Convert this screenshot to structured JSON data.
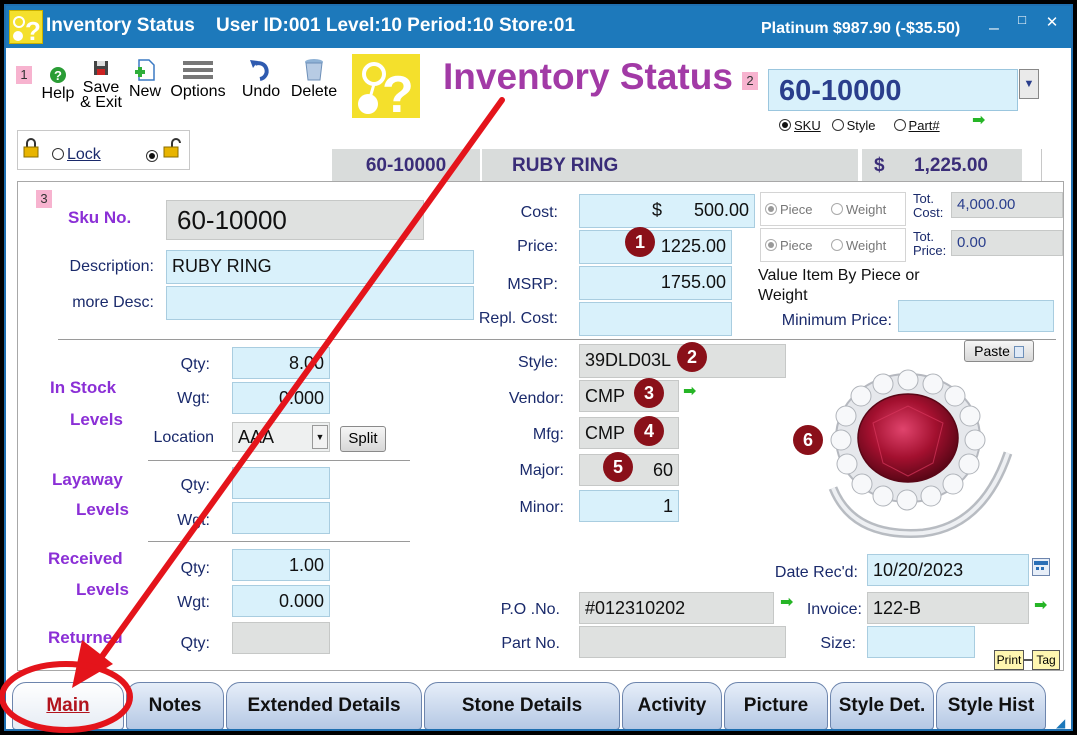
{
  "title_bar": {
    "title": "Inventory Status",
    "user_info": "User ID:001 Level:10 Period:10 Store:01",
    "balance": "Platinum $987.90 (-$35.50)",
    "minimize": "_",
    "maximize": "□",
    "close": "✕"
  },
  "markers": {
    "m1": "1",
    "m2": "2",
    "m3": "3"
  },
  "toolbar": {
    "help": "Help",
    "save_line1": "Save",
    "save_line2": "& Exit",
    "new": "New",
    "options": "Options",
    "undo": "Undo",
    "delete": "Delete"
  },
  "header": {
    "title": "Inventory Status",
    "sku_search_value": "60-10000",
    "search_modes": {
      "sku": "SKU",
      "style": "Style",
      "part": "Part#"
    }
  },
  "lock": {
    "label": "Lock"
  },
  "summary": {
    "sku": "60-10000",
    "description": "RUBY RING",
    "currency": "$",
    "price": "1,225.00"
  },
  "item": {
    "sku_label": "Sku No.",
    "sku_value": "60-10000",
    "description_label": "Description:",
    "description_value": "RUBY RING",
    "more_desc_label": "more Desc:",
    "more_desc_value": ""
  },
  "pricing": {
    "cost_label": "Cost:",
    "cost_currency": "$",
    "cost_value": "500.00",
    "price_label": "Price:",
    "price_value": "1225.00",
    "msrp_label": "MSRP:",
    "msrp_value": "1755.00",
    "repl_cost_label": "Repl. Cost:",
    "repl_cost_value": "",
    "piece_label": "Piece",
    "weight_label": "Weight",
    "tot_cost_label_1": "Tot.",
    "tot_cost_label_2": "Cost:",
    "tot_cost_value": "4,000.00",
    "tot_price_label_1": "Tot.",
    "tot_price_label_2": "Price:",
    "tot_price_value": "0.00",
    "value_by_line1": "Value Item By Piece or",
    "value_by_line2": "Weight",
    "min_price_label": "Minimum Price:",
    "min_price_value": ""
  },
  "stock": {
    "in_stock_line1": "In Stock",
    "in_stock_line2": "Levels",
    "qty_label": "Qty:",
    "wgt_label": "Wgt:",
    "in_qty": "8.00",
    "in_wgt": "0.000",
    "location_label": "Location",
    "location_value": "AAA",
    "split_label": "Split",
    "layaway_line1": "Layaway",
    "layaway_line2": "Levels",
    "layaway_qty": "",
    "layaway_wgt": "",
    "received_line1": "Received",
    "received_line2": "Levels",
    "received_qty": "1.00",
    "received_wgt": "0.000",
    "returned_label": "Returned",
    "returned_qty": ""
  },
  "attributes": {
    "style_label": "Style:",
    "style_value": "39DLD03L",
    "vendor_label": "Vendor:",
    "vendor_value": "CMP",
    "mfg_label": "Mfg:",
    "mfg_value": "CMP",
    "major_label": "Major:",
    "major_value": "60",
    "minor_label": "Minor:",
    "minor_value": "1"
  },
  "receiving": {
    "po_label": "P.O .No.",
    "po_value": "#012310202",
    "part_no_label": "Part No.",
    "part_no_value": "",
    "date_label": "Date Rec'd:",
    "date_value": "10/20/2023",
    "invoice_label": "Invoice:",
    "invoice_value": "122-B",
    "size_label": "Size:",
    "size_value": ""
  },
  "picture": {
    "paste_label": "Paste",
    "print_label": "Print",
    "tag_label": "Tag"
  },
  "badges": [
    "1",
    "2",
    "3",
    "4",
    "5",
    "6"
  ],
  "tabs": [
    {
      "label": "Main",
      "active": true
    },
    {
      "label": "Notes",
      "active": false
    },
    {
      "label": "Extended Details",
      "active": false
    },
    {
      "label": "Stone Details",
      "active": false
    },
    {
      "label": "Activity",
      "active": false
    },
    {
      "label": "Picture",
      "active": false
    },
    {
      "label": "Style Det.",
      "active": false
    },
    {
      "label": "Style Hist",
      "active": false
    }
  ],
  "colors": {
    "title_bar": "#1d79bb",
    "header_title": "#a23aa6",
    "section_label": "#8b2fd6",
    "field_blue": "#d9f1fb",
    "field_gray": "#dfe1e0",
    "badge": "#8a1019",
    "annotation": "#e4141b",
    "active_tab_text": "#b2141d"
  }
}
